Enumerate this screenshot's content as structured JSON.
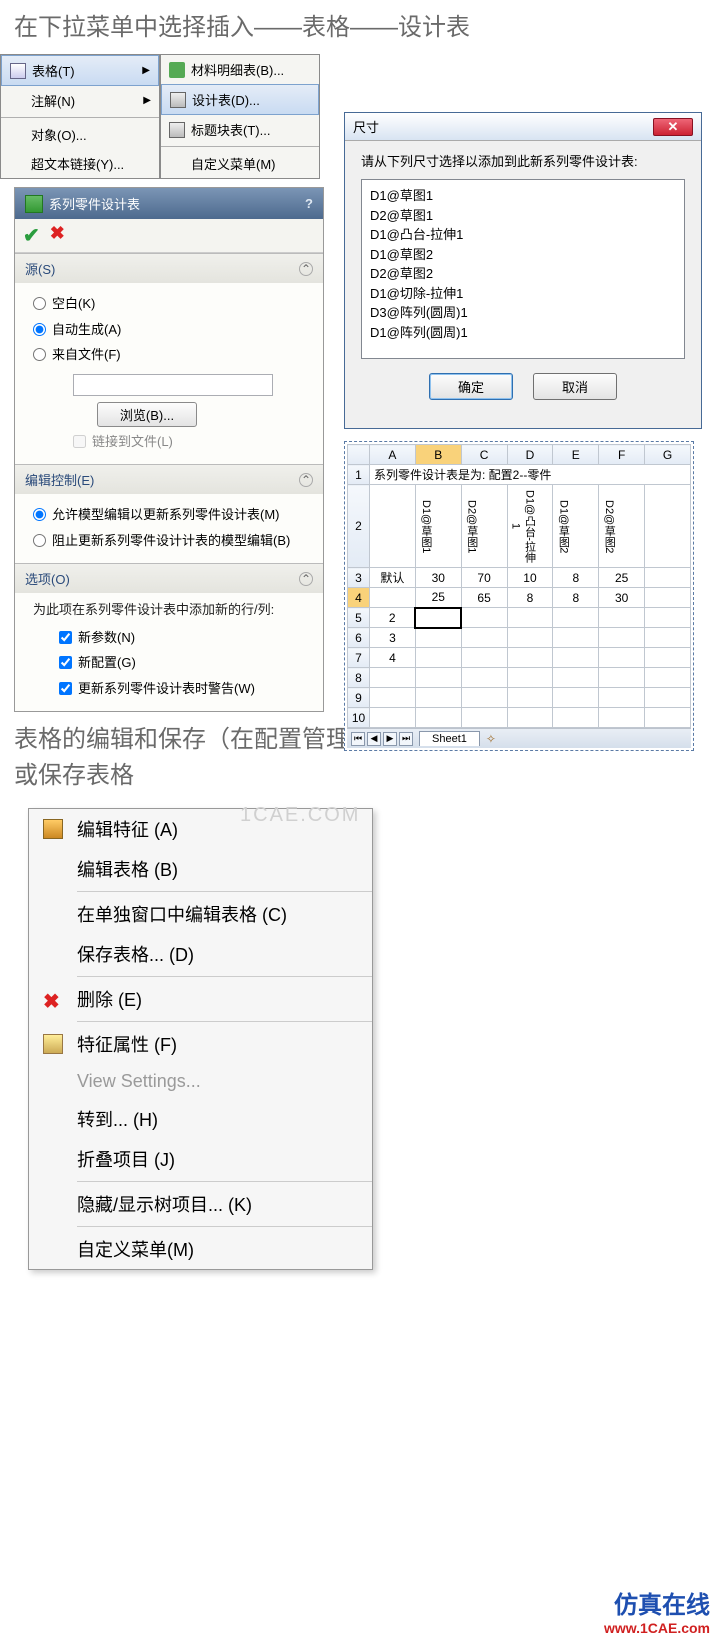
{
  "text": {
    "section1": "在下拉菜单中选择插入——表格——设计表",
    "section2": "表格的编辑和保存（在配置管理器中选择表格点击右键选择编辑或保存表格"
  },
  "insertMenu": {
    "left": [
      {
        "label": "表格(T)",
        "hl": true,
        "arrow": true,
        "icon": "table"
      },
      {
        "label": "注解(N)",
        "arrow": true
      },
      {
        "sep": true
      },
      {
        "label": "对象(O)..."
      },
      {
        "label": "超文本链接(Y)...",
        "icon": "globe"
      }
    ],
    "right": [
      {
        "label": "材料明细表(B)...",
        "icon": "green"
      },
      {
        "label": "设计表(D)...",
        "hl": true,
        "icon": "grid"
      },
      {
        "label": "标题块表(T)...",
        "icon": "grid"
      },
      {
        "sep": true
      },
      {
        "label": "自定义菜单(M)"
      }
    ]
  },
  "sizeDialog": {
    "title": "尺寸",
    "label": "请从下列尺寸选择以添加到此新系列零件设计表:",
    "items": [
      "D1@草图1",
      "D2@草图1",
      "D1@凸台-拉伸1",
      "D1@草图2",
      "D2@草图2",
      "D1@切除-拉伸1",
      "D3@阵列(圆周)1",
      "D1@阵列(圆周)1"
    ],
    "ok": "确定",
    "cancel": "取消"
  },
  "pm": {
    "title": "系列零件设计表",
    "groups": {
      "source": {
        "title": "源(S)",
        "radios": [
          {
            "label": "空白(K)",
            "checked": false
          },
          {
            "label": "自动生成(A)",
            "checked": true
          },
          {
            "label": "来自文件(F)",
            "checked": false
          }
        ],
        "browse": "浏览(B)...",
        "link": "链接到文件(L)"
      },
      "edit": {
        "title": "编辑控制(E)",
        "radios": [
          {
            "label": "允许模型编辑以更新系列零件设计表(M)",
            "checked": true
          },
          {
            "label": "阻止更新系列零件设计计表的模型编辑(B)",
            "checked": false
          }
        ]
      },
      "options": {
        "title": "选项(O)",
        "note": "为此项在系列零件设计表中添加新的行/列:",
        "checks": [
          {
            "label": "新参数(N)",
            "checked": true
          },
          {
            "label": "新配置(G)",
            "checked": true
          },
          {
            "label": "更新系列零件设计表时警告(W)",
            "checked": true
          }
        ]
      }
    }
  },
  "sheet": {
    "line1": "系列零件设计表是为:   配置2--零件",
    "colHdr": [
      "",
      "A",
      "B",
      "C",
      "D",
      "E",
      "F",
      "G"
    ],
    "vert": [
      "D1@草图1",
      "D2@草图1",
      "D1@凸台-拉伸1",
      "D1@草图2",
      "D2@草图2"
    ],
    "rows": [
      {
        "n": "3",
        "cells": [
          "默认",
          "30",
          "70",
          "10",
          "8",
          "25",
          ""
        ]
      },
      {
        "n": "4",
        "cells": [
          "",
          "25",
          "65",
          "8",
          "8",
          "30",
          ""
        ]
      },
      {
        "n": "5",
        "cells": [
          "2",
          "",
          "",
          "",
          "",
          "",
          ""
        ]
      },
      {
        "n": "6",
        "cells": [
          "3",
          "",
          "",
          "",
          "",
          "",
          ""
        ]
      },
      {
        "n": "7",
        "cells": [
          "4",
          "",
          "",
          "",
          "",
          "",
          ""
        ]
      },
      {
        "n": "8",
        "cells": [
          "",
          "",
          "",
          "",
          "",
          "",
          ""
        ]
      },
      {
        "n": "9",
        "cells": [
          "",
          "",
          "",
          "",
          "",
          "",
          ""
        ]
      },
      {
        "n": "10",
        "cells": [
          "",
          "",
          "",
          "",
          "",
          "",
          ""
        ]
      }
    ],
    "tab": "Sheet1"
  },
  "ctx": {
    "items": [
      {
        "label": "编辑特征 (A)",
        "icon": "feat"
      },
      {
        "label": "编辑表格 (B)"
      },
      {
        "sep": true
      },
      {
        "label": "在单独窗口中编辑表格 (C)"
      },
      {
        "label": "保存表格... (D)"
      },
      {
        "sep": true
      },
      {
        "label": "删除 (E)",
        "icon": "del"
      },
      {
        "sep": true
      },
      {
        "label": "特征属性 (F)",
        "icon": "prop"
      },
      {
        "label": "View Settings...",
        "disabled": true
      },
      {
        "label": "转到... (H)"
      },
      {
        "label": "折叠项目 (J)"
      },
      {
        "sep": true
      },
      {
        "label": "隐藏/显示树项目... (K)"
      },
      {
        "sep": true
      },
      {
        "label": "自定义菜单(M)"
      }
    ]
  },
  "watermark": "1CAE.COM",
  "brand": {
    "b1": "仿真在线",
    "b2": "www.1CAE.com"
  }
}
